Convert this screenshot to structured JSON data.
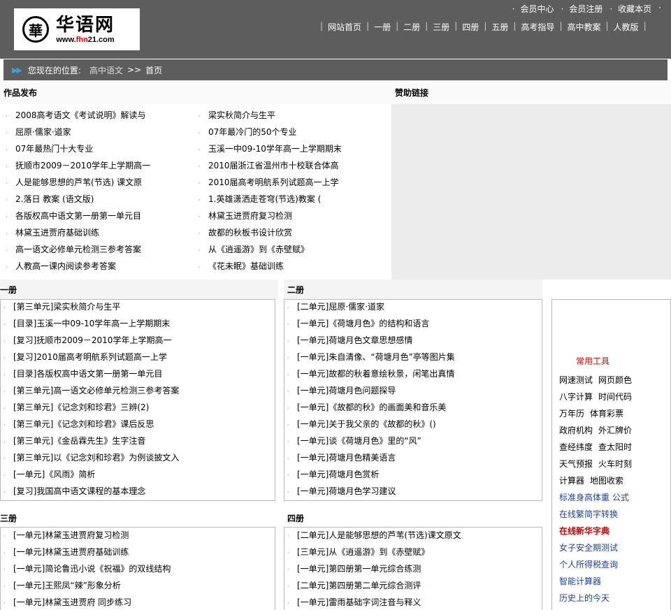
{
  "site": {
    "logo_seal_char": "華",
    "logo_cn": "华语网",
    "logo_url_pre": "www.",
    "logo_url_red": "fhn",
    "logo_url_post": "21.com"
  },
  "top_links": [
    "会员中心",
    "会员注册",
    "收藏本页"
  ],
  "main_nav": [
    "网站首页",
    "一册",
    "二册",
    "三册",
    "四册",
    "五册",
    "高考指导",
    "高中教案",
    "人教版"
  ],
  "breadcrumb": {
    "prefix": "您现在的位置:",
    "link": "高中语文",
    "separator": ">>",
    "current": "首页"
  },
  "works": {
    "title": "作品发布",
    "left": [
      "2008高考语文《考试说明》解读与",
      "屈原·儒家·道家",
      "07年最热门十大专业",
      "抚顺市2009－2010学年上学期高一",
      "人是能够思想的芦苇(节选) 课文原",
      "2.落日 教案 (语文版)",
      "各版权高中语文第一册第一单元目",
      "林黛玉进贾府基础训练",
      "高一语文必修单元检测三参考答案",
      "人教高一课内阅读参考答案"
    ],
    "right": [
      "梁实秋简介与生平",
      "07年最冷门的50个专业",
      "玉溪一中09-10学年高一上学期期末",
      "2010届浙江省温州市十校联合体高",
      "2010届高考明航系列试题高一上学",
      "1.英雄潇洒走苍穹(节选)教案 (",
      "林黛玉进贾府复习检测",
      "故都的秋板书设计欣赏",
      "从《逍遥游》到《赤壁赋》",
      "《花未眠》基础训练"
    ]
  },
  "sponsor": {
    "title": "赞助链接"
  },
  "book1": {
    "title": "一册",
    "items": [
      "[第三单元]梁实秋简介与生平",
      "[目录]玉溪一中09-10学年高一上学期期末",
      "[复习]抚顺市2009－2010学年上学期高一",
      "[复习]2010届高考明航系列试题高一上学",
      "[目录]各版权高中语文第一册第一单元目",
      "[第三单元]高一语文必修单元检测三参考答案",
      "[第三单元]《记念刘和珍君》三辨(2)",
      "[第三单元]《记念刘和珍君》课后反思",
      "[第三单元]《金岳霖先生》生字注音",
      "[第三单元]以《记念刘和珍君》为例谈披文入",
      "[一单元]《风雨》简析",
      "[复习]我国高中语文课程的基本理念"
    ]
  },
  "book2": {
    "title": "二册",
    "items": [
      "[二单元]屈原·儒家·道家",
      "[一单元]《荷塘月色》的结构和语言",
      "[一单元]荷塘月色文章思想感情",
      "[一单元]朱自清像、“荷塘月色”亭等图片集",
      "[一单元]故都的秋着意绘秋景，闲笔出真情",
      "[一单元]荷塘月色问题探导",
      "[一单元]《故都的秋》的画面美和音乐美",
      "[一单元]关于我父亲的《故都的秋》()",
      "[一单元]谈《荷塘月色》里的“风”",
      "[一单元]荷塘月色精美语言",
      "[一单元]荷塘月色赏析",
      "[一单元]荷塘月色学习建议"
    ]
  },
  "book3": {
    "title": "三册",
    "items": [
      "[一单元]林黛玉进贾府复习检测",
      "[一单元]林黛玉进贾府基础训练",
      "[一单元]简论鲁迅小说《祝福》的双线结构",
      "[一单元]王熙凤“辣”形象分析",
      "[一单元]林黛玉进贾府 同步练习"
    ]
  },
  "book4": {
    "title": "四册",
    "items": [
      "[二单元]人是能够思想的芦苇(节选)课文原文",
      "[三单元]从《逍遥游》到《赤壁赋》",
      "[一单元]第四册第一单元综合练测",
      "[二单元]第四册第二单元综合测评",
      "[一单元]雷雨基础字词注音与释义"
    ]
  },
  "tools": {
    "title": "常用工具",
    "rows": [
      [
        "网速测试",
        "网页颜色"
      ],
      [
        "八字计算",
        "时间代码"
      ],
      [
        "万年历",
        "体育彩票"
      ],
      [
        "政府机构",
        "外汇牌价"
      ],
      [
        "查经纬度",
        "查太阳时"
      ],
      [
        "天气预报",
        "火车时刻"
      ],
      [
        "计算器",
        "地图收索"
      ]
    ],
    "blue_links": [
      "标准身高体重 公式",
      "在线繁简字转换"
    ],
    "highlight": "在线新华字典",
    "blue_links2": [
      "女子安全期测试",
      "个人所得税查询",
      "智能计算器",
      "历史上的今天"
    ]
  },
  "colors": {
    "header_bg": "#5d5d5d",
    "accent_red": "#cc0000",
    "link_blue": "#1f3fa0"
  }
}
